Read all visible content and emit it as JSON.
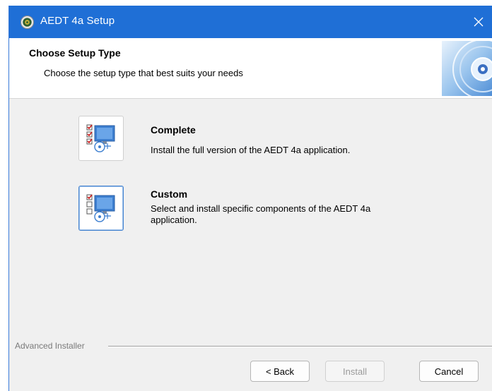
{
  "window": {
    "title": "AEDT 4a Setup",
    "close_glyph": "✕"
  },
  "header": {
    "title": "Choose Setup Type",
    "subtitle": "Choose the setup type that best suits your needs"
  },
  "options": [
    {
      "title": "Complete",
      "description": "Install the full version of the AEDT 4a application."
    },
    {
      "title": "Custom",
      "description": "Select and install specific components of the AEDT 4a application."
    }
  ],
  "branding": {
    "text": "Advanced Installer"
  },
  "buttons": {
    "back": "< Back",
    "install": "Install",
    "cancel": "Cancel"
  },
  "colors": {
    "titlebar": "#1f6fd6",
    "dialog_bg": "#f0f0f0",
    "accent": "#4a86d0"
  },
  "icons": {
    "app": "installer-seal-icon",
    "close": "close-icon",
    "header": "cd-disc-icon",
    "complete": "complete-setup-icon",
    "custom": "custom-setup-icon"
  }
}
